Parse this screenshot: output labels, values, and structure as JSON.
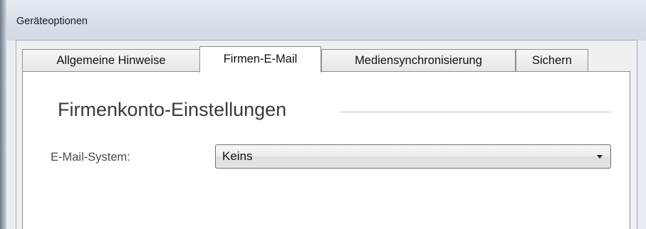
{
  "window": {
    "title": "Geräteoptionen"
  },
  "tabs": [
    {
      "label": "Allgemeine Hinweise",
      "active": false
    },
    {
      "label": "Firmen-E-Mail",
      "active": true
    },
    {
      "label": "Mediensynchronisierung",
      "active": false
    },
    {
      "label": "Sichern",
      "active": false
    }
  ],
  "panel": {
    "section_title": "Firmenkonto-Einstellungen",
    "email_system": {
      "label": "E-Mail-System:",
      "selected_value": "Keins",
      "dropdown_icon": "chevron-down-icon"
    }
  }
}
